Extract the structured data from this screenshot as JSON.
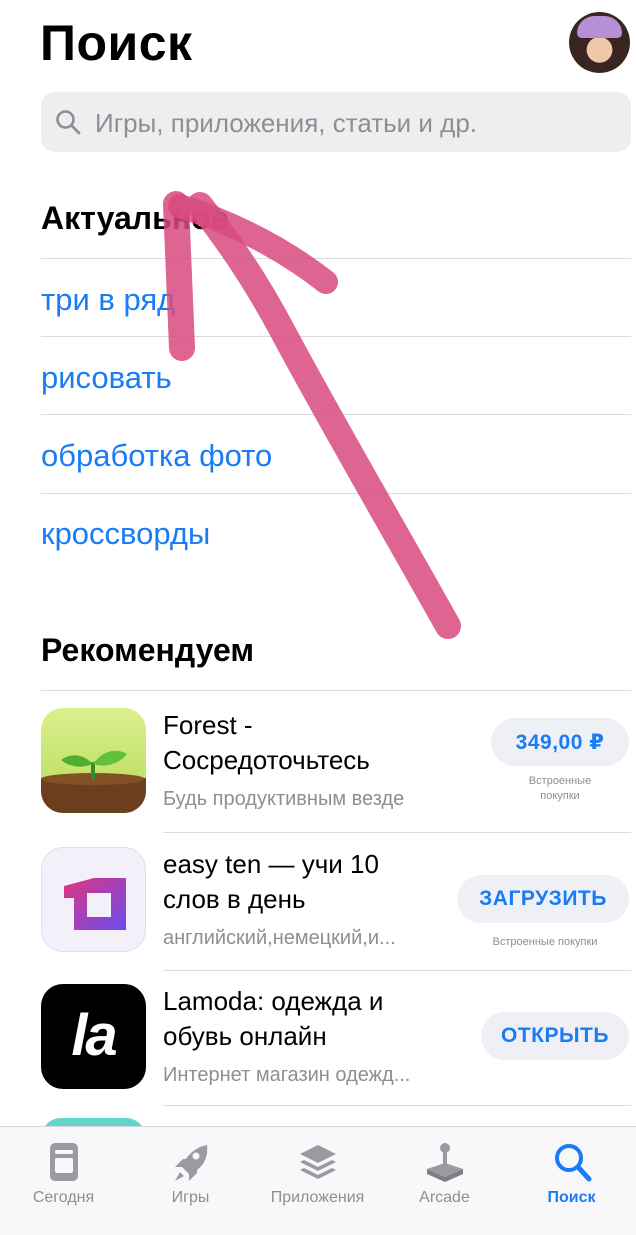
{
  "page": {
    "title": "Поиск"
  },
  "search": {
    "placeholder": "Игры, приложения, статьи и др."
  },
  "trending": {
    "title": "Актуальное",
    "items": [
      "три в ряд",
      "рисовать",
      "обработка фото",
      "кроссворды"
    ]
  },
  "recommended": {
    "title": "Рекомендуем",
    "apps": [
      {
        "name_line1": "Forest -",
        "name_line2": "Сосредоточьтесь",
        "subtitle": "Будь продуктивным везде",
        "button": "349,00 ₽",
        "iap": "Встроенные\nпокупки"
      },
      {
        "name_line1": "easy ten — учи 10",
        "name_line2": "слов в день",
        "subtitle": "английский,немецкий,и...",
        "button": "ЗАГРУЗИТЬ",
        "iap": "Встроенные покупки"
      },
      {
        "name_line1": "Lamoda: одежда и",
        "name_line2": "обувь онлайн",
        "subtitle": "Интернет магазин одежд...",
        "button": "ОТКРЫТЬ",
        "icon_text": "la"
      }
    ]
  },
  "tabbar": {
    "tabs": [
      {
        "label": "Сегодня",
        "icon": "today-icon"
      },
      {
        "label": "Игры",
        "icon": "rocket-icon"
      },
      {
        "label": "Приложения",
        "icon": "apps-stack-icon"
      },
      {
        "label": "Arcade",
        "icon": "joystick-icon"
      },
      {
        "label": "Поиск",
        "icon": "search-icon"
      }
    ],
    "active_index": 4
  },
  "colors": {
    "accent": "#1a7cf5",
    "annotation_arrow": "#d84a7e"
  }
}
